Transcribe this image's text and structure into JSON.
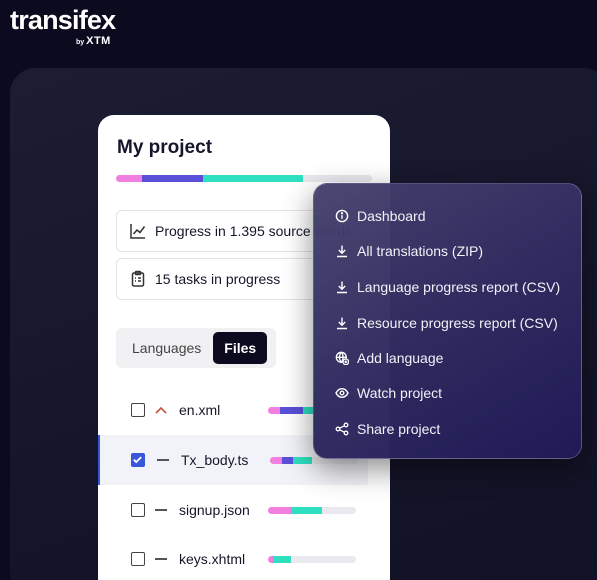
{
  "brand": {
    "name": "transifex",
    "by": "by",
    "partner": "XTM"
  },
  "project": {
    "title": "My project",
    "progress": [
      {
        "fraction": 0.1,
        "color": "#f27ee0"
      },
      {
        "fraction": 0.24,
        "color": "#5a4fd8"
      },
      {
        "fraction": 0.39,
        "color": "#2ee0c0"
      }
    ],
    "progress_text": "Progress in 1.395 source words",
    "tasks_text": "15 tasks in progress",
    "tabs": [
      {
        "label": "Languages",
        "active": false
      },
      {
        "label": "Files",
        "active": true
      }
    ],
    "files": [
      {
        "name": "en.xml",
        "checked": false,
        "marker": "chevron-up",
        "bar": [
          [
            "#f27ee0",
            0.14
          ],
          [
            "#5a4fd8",
            0.26
          ],
          [
            "#2ee0c0",
            0.12
          ]
        ]
      },
      {
        "name": "Tx_body.ts",
        "checked": true,
        "marker": "dash",
        "bar": [
          [
            "#f27ee0",
            0.14
          ],
          [
            "#5a4fd8",
            0.12
          ],
          [
            "#2ee0c0",
            0.22
          ]
        ]
      },
      {
        "name": "signup.json",
        "checked": false,
        "marker": "dash",
        "bar": [
          [
            "#f27ee0",
            0.26
          ],
          [
            "#2ee0c0",
            0.35
          ]
        ]
      },
      {
        "name": "keys.xhtml",
        "checked": false,
        "marker": "dash",
        "bar": [
          [
            "#f27ee0",
            0.06
          ],
          [
            "#2ee0c0",
            0.2
          ]
        ]
      }
    ]
  },
  "menu": {
    "items": [
      {
        "label": "Dashboard",
        "icon": "info-icon"
      },
      {
        "label": "All translations (ZIP)",
        "icon": "download-icon"
      },
      {
        "label": "Language progress report (CSV)",
        "icon": "download-icon"
      },
      {
        "label": "Resource progress report (CSV)",
        "icon": "download-icon"
      },
      {
        "label": "Add language",
        "icon": "globe-plus-icon"
      },
      {
        "label": "Watch project",
        "icon": "eye-icon"
      },
      {
        "label": "Share project",
        "icon": "share-icon"
      }
    ]
  }
}
